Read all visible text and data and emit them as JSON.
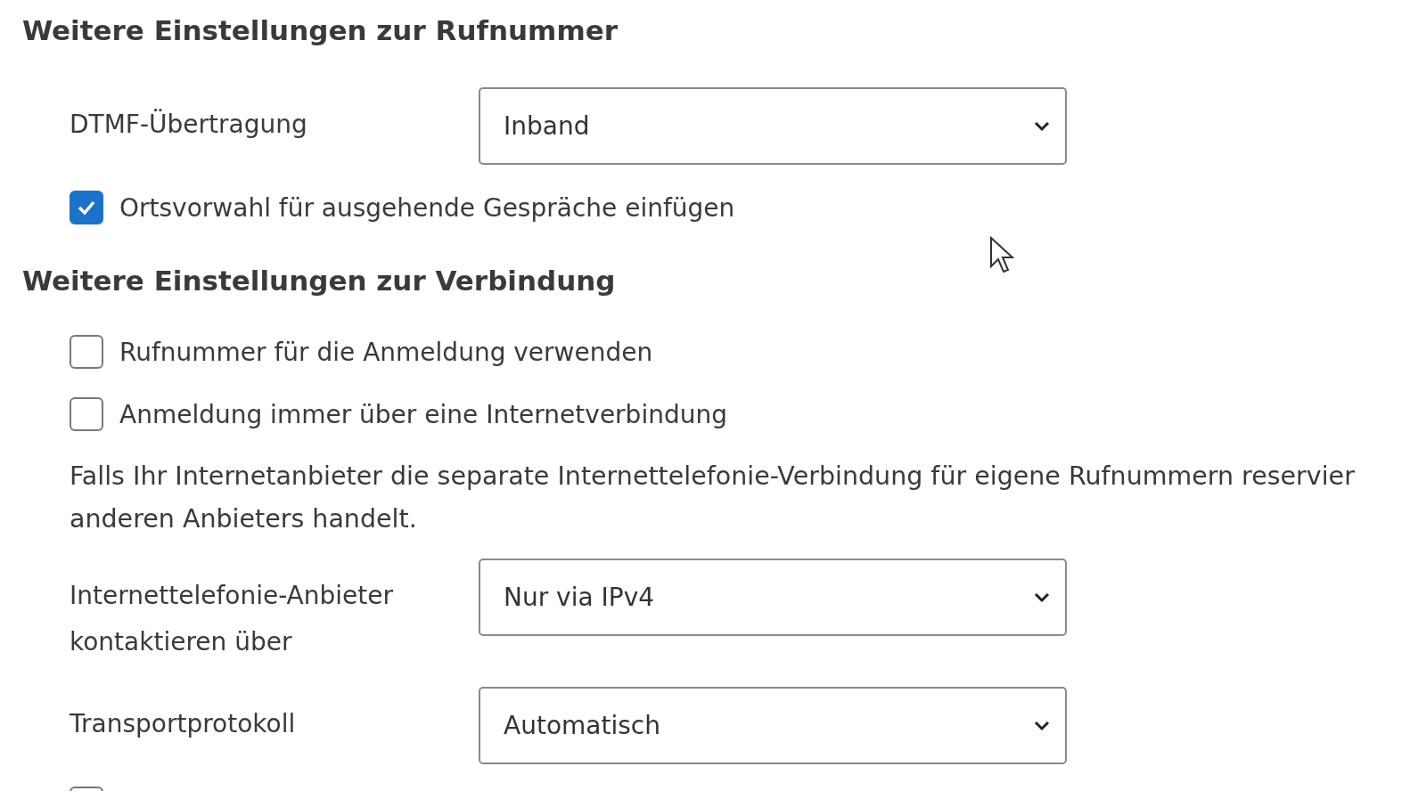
{
  "sections": [
    {
      "title": "Weitere Einstellungen zur Rufnummer",
      "items": [
        {
          "kind": "select",
          "label": [
            "DTMF-Übertragung"
          ],
          "value": "Inband"
        },
        {
          "kind": "checkbox",
          "label": "Ortsvorwahl für ausgehende Gespräche einfügen",
          "checked": true
        }
      ]
    },
    {
      "title": "Weitere Einstellungen zur Verbindung",
      "items": [
        {
          "kind": "checkbox",
          "label": "Rufnummer für die Anmeldung verwenden",
          "checked": false
        },
        {
          "kind": "checkbox",
          "label": "Anmeldung immer über eine Internetverbindung",
          "checked": false
        },
        {
          "kind": "text",
          "lines": [
            "Falls Ihr Internetanbieter die separate Internettelefonie-Verbindung für eigene Rufnummern reservier",
            "anderen Anbieters handelt."
          ]
        },
        {
          "kind": "select",
          "label": [
            "Internettelefonie-Anbieter",
            "kontaktieren über"
          ],
          "value": "Nur via IPv4"
        },
        {
          "kind": "select",
          "label": [
            "Transportprotokoll"
          ],
          "value": "Automatisch"
        },
        {
          "kind": "checkbox",
          "checked": false
        }
      ]
    }
  ]
}
